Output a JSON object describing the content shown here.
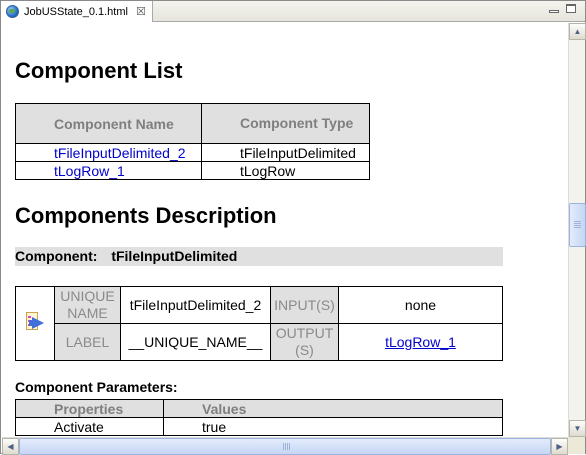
{
  "tab": {
    "title": "JobUSState_0.1.html",
    "close_glyph": "☒",
    "icon": "globe-icon"
  },
  "window_controls": {
    "minimize_icon": "minimize-icon",
    "maximize_icon": "maximize-icon"
  },
  "page": {
    "component_list_title": "Component List",
    "components_description_title": "Components Description",
    "component_list": {
      "headers": [
        "Component Name",
        "Component Type"
      ],
      "rows": [
        {
          "name": "tFileInputDelimited_2",
          "type": "tFileInputDelimited"
        },
        {
          "name": "tLogRow_1",
          "type": "tLogRow"
        }
      ]
    },
    "component_header": {
      "label": "Component:",
      "name": "tFileInputDelimited"
    },
    "component_table": {
      "icon": "file-input-component-icon",
      "unique_name_label": "UNIQUE NAME",
      "unique_name_value": "tFileInputDelimited_2",
      "inputs_label": "INPUT(S)",
      "inputs_value": "none",
      "label_label": "LABEL",
      "label_value": "__UNIQUE_NAME__",
      "outputs_label": "OUTPUT (S)",
      "outputs_value": "tLogRow_1"
    },
    "parameters": {
      "title": "Component Parameters:",
      "headers": [
        "Properties",
        "Values"
      ],
      "rows": [
        {
          "property": "Activate",
          "value": "true"
        }
      ]
    }
  },
  "colors": {
    "link": "#0000cc",
    "header_bg": "#e0e0e0",
    "header_text": "#7f7f7f"
  }
}
